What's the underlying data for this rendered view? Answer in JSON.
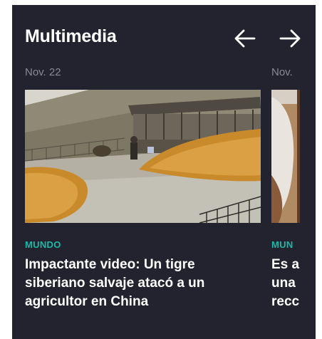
{
  "section": {
    "title": "Multimedia",
    "prev_icon": "arrow-left-icon",
    "next_icon": "arrow-right-icon"
  },
  "cards": [
    {
      "date": "Nov. 22",
      "category": "MUNDO",
      "headline": "Impactante video: Un tigre siberiano salvaje atacó a un agricultor en China"
    },
    {
      "date": "Nov.",
      "category": "MUN",
      "headline": "Es a\nuna\nrecc"
    }
  ],
  "colors": {
    "panel_bg": "#23232f",
    "accent": "#1eb8a8",
    "date_text": "#8a8a97",
    "headline_text": "#ffffff"
  }
}
